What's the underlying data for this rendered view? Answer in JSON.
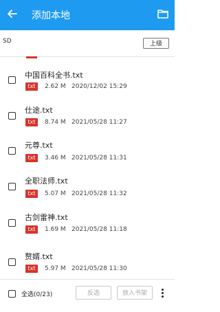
{
  "header": {
    "title": "添加本地",
    "back_icon": "arrow-left-icon",
    "folder_icon": "folder-icon",
    "color": "#1e9bf0"
  },
  "path_bar": {
    "path": "SD",
    "up_label": "上级"
  },
  "files": [
    {
      "name": "中国百科全书.txt",
      "type": "txt",
      "size": "2.62 M",
      "date": "2020/12/02 15:29"
    },
    {
      "name": "仕途.txt",
      "type": "txt",
      "size": "8.74 M",
      "date": "2021/05/28 11:27"
    },
    {
      "name": "元尊.txt",
      "type": "txt",
      "size": "3.46 M",
      "date": "2021/05/28 11:31"
    },
    {
      "name": "全职法师.txt",
      "type": "txt",
      "size": "5.07 M",
      "date": "2021/05/28 11:32"
    },
    {
      "name": "古剑雷神.txt",
      "type": "txt",
      "size": "1.69 M",
      "date": "2021/05/28 11:18"
    },
    {
      "name": "赘婿.txt",
      "type": "txt",
      "size": "5.97 M",
      "date": "2021/05/28 11:30"
    }
  ],
  "bottom": {
    "select_all_label": "全选(0/23)",
    "invert_label": "反选",
    "add_label": "放入书架",
    "more_icon": "more-vertical-icon"
  },
  "colors": {
    "tag": "#d8342a"
  }
}
